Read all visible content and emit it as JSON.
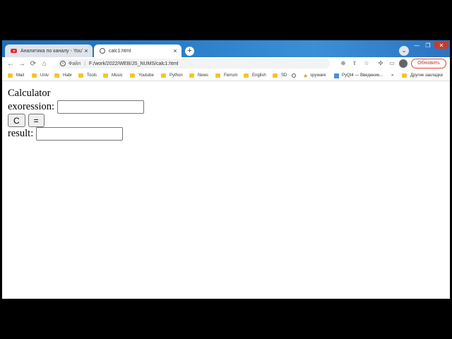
{
  "browser": {
    "tabs": [
      {
        "title": "Аналитика по каналу - YouTube",
        "icon": "youtube-icon"
      },
      {
        "title": "calc1.html",
        "icon": "globe-icon"
      }
    ],
    "new_tab": "+",
    "tab_search": "⌄",
    "window_controls": {
      "minimize": "—",
      "maximize": "❐",
      "close": "✕"
    },
    "nav": {
      "back": "←",
      "forward": "→",
      "reload": "⟳",
      "home": "⌂"
    },
    "address": {
      "label": "Файл",
      "separator": "|",
      "url": "F:/work/2022/WEB/JS_NUMS/calc1.html"
    },
    "toolbar_icons": {
      "zoom": "⊕",
      "share": "⇪",
      "bookmark": "☆",
      "extensions": "✣",
      "sidepanel": "▭"
    },
    "update_button": "Обновить",
    "bookmarks": [
      "Mail",
      "Univ",
      "Habr",
      "Tools",
      "Music",
      "Youtube",
      "Python",
      "News",
      "Ferrum",
      "English",
      "SD"
    ],
    "bookmark_spyware": "spyware",
    "bookmark_pyqt": "PyQt4 — Введение...",
    "bookmarks_more": "»",
    "other_bookmarks": "Другие закладки"
  },
  "page": {
    "title": "Calculator",
    "expression_label": "exoression:",
    "expression_value": "",
    "clear_button": "C",
    "equals_button": "=",
    "result_label": "result:",
    "result_value": ""
  },
  "colors": {
    "accent": "#2a7fc8",
    "update": "#d9483b",
    "folder": "#f4c430"
  }
}
